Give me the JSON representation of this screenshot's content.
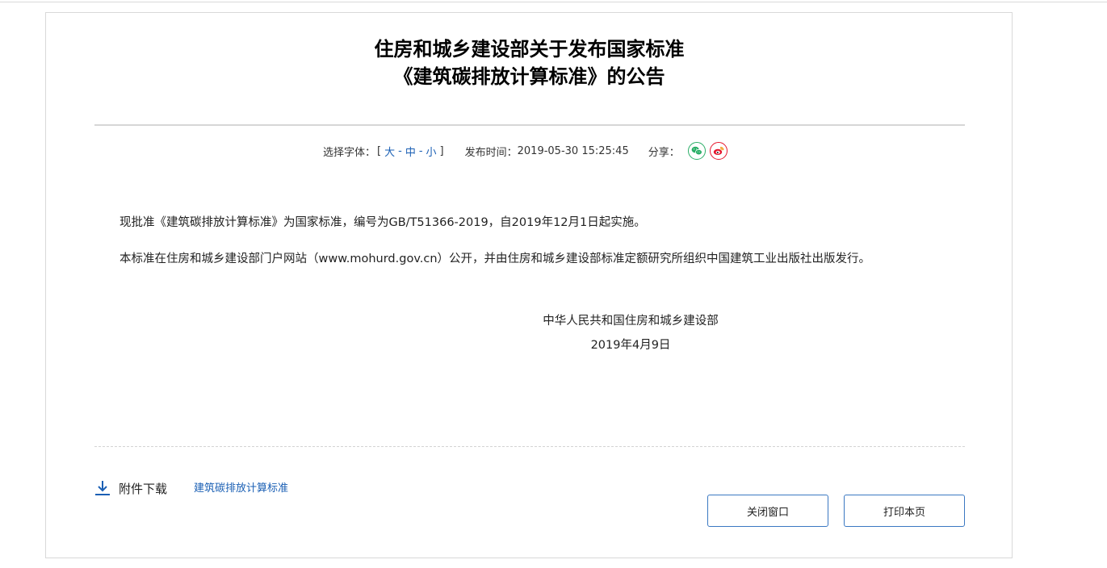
{
  "article": {
    "title_line1": "住房和城乡建设部关于发布国家标准",
    "title_line2": "《建筑碳排放计算标准》的公告"
  },
  "meta": {
    "font_label": "选择字体：",
    "bracket_open": "[",
    "bracket_close": "]",
    "font_sizes": [
      "大",
      "中",
      "小"
    ],
    "separator": "-",
    "publish_label": "发布时间：",
    "publish_time": "2019-05-30 15:25:45",
    "share_label": "分享：",
    "share_icons": [
      "wechat-icon",
      "weibo-icon"
    ]
  },
  "body": {
    "paragraphs": [
      "现批准《建筑碳排放计算标准》为国家标准，编号为GB/T51366-2019，自2019年12月1日起实施。",
      "本标准在住房和城乡建设部门户网站（www.mohurd.gov.cn）公开，并由住房和城乡建设部标准定额研究所组织中国建筑工业出版社出版发行。"
    ]
  },
  "signature": {
    "issuer": "中华人民共和国住房和城乡建设部",
    "date": "2019年4月9日"
  },
  "attachment": {
    "label": "附件下载",
    "file_link": "建筑碳排放计算标准"
  },
  "buttons": {
    "close_label": "关闭窗口",
    "print_label": "打印本页"
  },
  "colors": {
    "link": "#1a5fb4",
    "button_border": "#3a78c2",
    "wechat": "#2aae67",
    "weibo": "#e6162d"
  }
}
